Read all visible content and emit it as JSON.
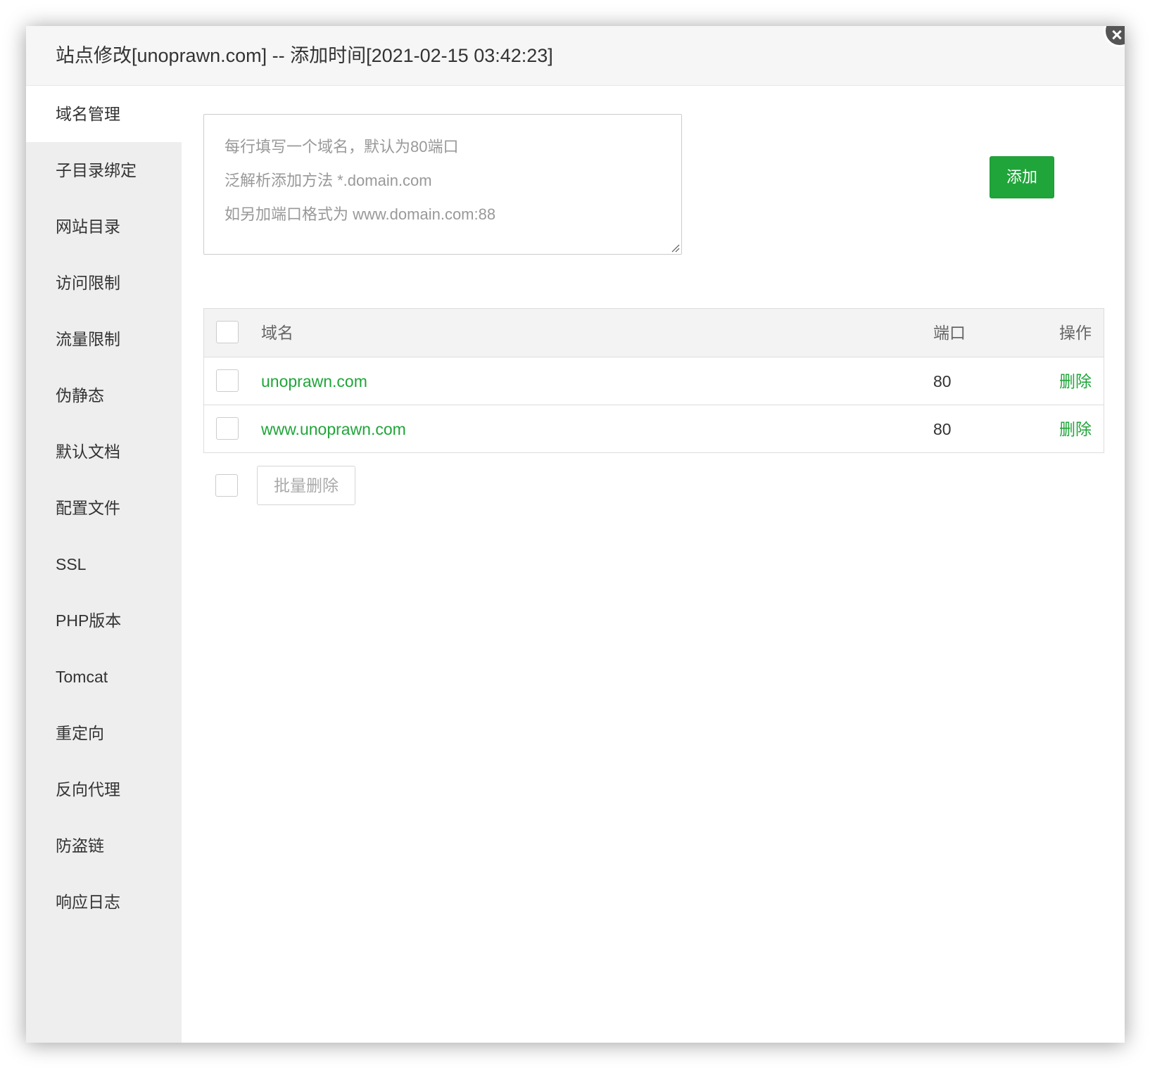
{
  "dialog": {
    "title": "站点修改[unoprawn.com] -- 添加时间[2021-02-15 03:42:23]"
  },
  "sidebar": {
    "items": [
      {
        "label": "域名管理",
        "active": true
      },
      {
        "label": "子目录绑定"
      },
      {
        "label": "网站目录"
      },
      {
        "label": "访问限制"
      },
      {
        "label": "流量限制"
      },
      {
        "label": "伪静态"
      },
      {
        "label": "默认文档"
      },
      {
        "label": "配置文件"
      },
      {
        "label": "SSL"
      },
      {
        "label": "PHP版本"
      },
      {
        "label": "Tomcat"
      },
      {
        "label": "重定向"
      },
      {
        "label": "反向代理"
      },
      {
        "label": "防盗链"
      },
      {
        "label": "响应日志"
      }
    ]
  },
  "domain_input": {
    "value": "",
    "placeholder_lines": [
      "每行填写一个域名，默认为80端口",
      "泛解析添加方法 *.domain.com",
      "如另加端口格式为 www.domain.com:88"
    ]
  },
  "add_button": {
    "label": "添加"
  },
  "table": {
    "headers": {
      "domain": "域名",
      "port": "端口",
      "action": "操作"
    },
    "rows": [
      {
        "domain": "unoprawn.com",
        "port": "80",
        "action": "删除"
      },
      {
        "domain": "www.unoprawn.com",
        "port": "80",
        "action": "删除"
      }
    ]
  },
  "bulk_delete_button": {
    "label": "批量删除"
  },
  "colors": {
    "accent_green": "#20a53a",
    "sidebar_bg": "#eeeeee",
    "titlebar_bg": "#f6f6f6"
  }
}
